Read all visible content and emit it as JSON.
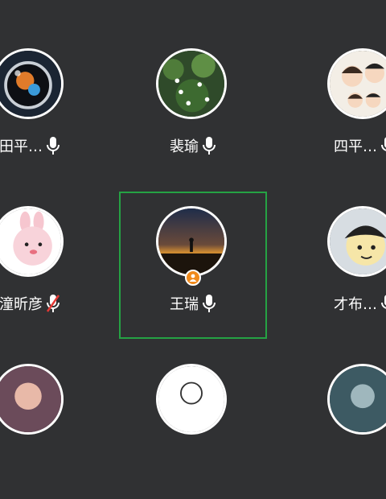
{
  "participants": [
    {
      "name": "田平…",
      "mic": "on",
      "avatar": "astronaut-avatar"
    },
    {
      "name": "裴瑜",
      "mic": "on",
      "avatar": "flowers-avatar"
    },
    {
      "name": "四平…",
      "mic": "on",
      "avatar": "couple-cartoon-avatar"
    },
    {
      "name": "潼昕彦",
      "mic": "muted",
      "avatar": "pink-rabbit-avatar"
    },
    {
      "name": "王瑞",
      "mic": "on",
      "avatar": "sunset-silhouette-avatar",
      "active_speaker": true,
      "host": true
    },
    {
      "name": "才布…",
      "mic": "on",
      "avatar": "cartoon-boy-avatar"
    }
  ],
  "colors": {
    "background": "#303133",
    "active_border": "#25a244",
    "host_badge": "#f08a1c",
    "muted_slash": "#e53935"
  },
  "icons": {
    "mic_on": "microphone-icon",
    "mic_muted": "microphone-muted-icon",
    "host": "host-person-icon"
  }
}
